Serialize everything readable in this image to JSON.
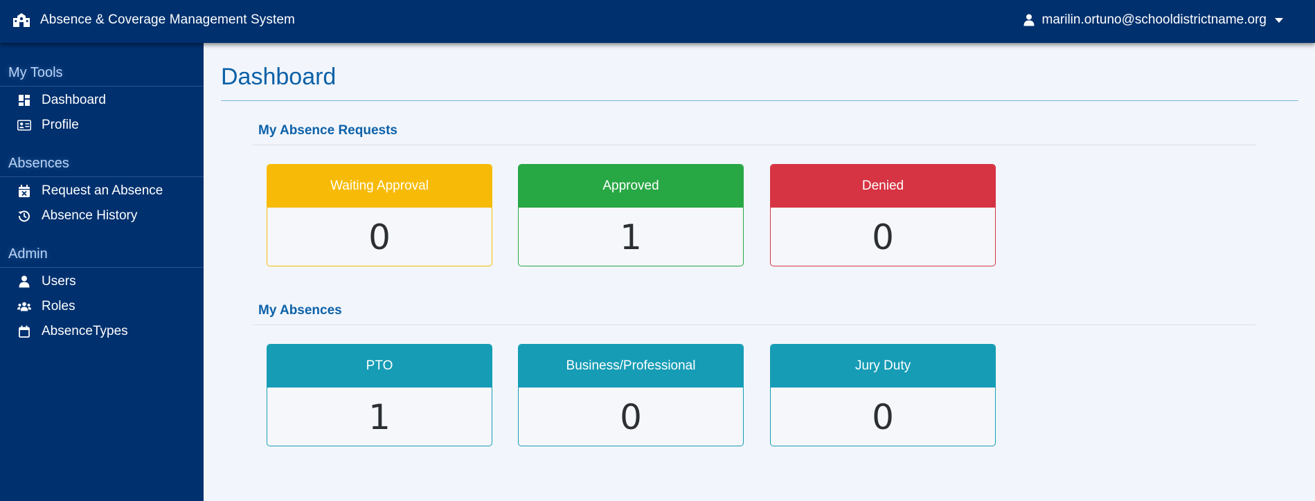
{
  "app": {
    "title": "Absence & Coverage Management System",
    "user_email": "marilin.ortuno@schooldistrictname.org"
  },
  "sidebar": {
    "sections": [
      {
        "heading": "My Tools",
        "items": [
          {
            "label": "Dashboard",
            "icon": "dashboard-icon"
          },
          {
            "label": "Profile",
            "icon": "id-card-icon"
          }
        ]
      },
      {
        "heading": "Absences",
        "items": [
          {
            "label": "Request an Absence",
            "icon": "calendar-x-icon"
          },
          {
            "label": "Absence History",
            "icon": "history-icon"
          }
        ]
      },
      {
        "heading": "Admin",
        "items": [
          {
            "label": "Users",
            "icon": "user-icon"
          },
          {
            "label": "Roles",
            "icon": "users-icon"
          },
          {
            "label": "AbsenceTypes",
            "icon": "calendar-icon"
          }
        ]
      }
    ]
  },
  "main": {
    "page_title": "Dashboard",
    "requests": {
      "title": "My Absence Requests",
      "cards": [
        {
          "label": "Waiting Approval",
          "value": "0",
          "color": "#f7bb07"
        },
        {
          "label": "Approved",
          "value": "1",
          "color": "#28a745"
        },
        {
          "label": "Denied",
          "value": "0",
          "color": "#d63343"
        }
      ]
    },
    "absences": {
      "title": "My Absences",
      "cards": [
        {
          "label": "PTO",
          "value": "1",
          "color": "#169cb5"
        },
        {
          "label": "Business/Professional",
          "value": "0",
          "color": "#169cb5"
        },
        {
          "label": "Jury Duty",
          "value": "0",
          "color": "#169cb5"
        }
      ]
    }
  },
  "colors": {
    "navy": "#00306e",
    "title_blue": "#0d61a8",
    "background": "#f2f6fc"
  }
}
